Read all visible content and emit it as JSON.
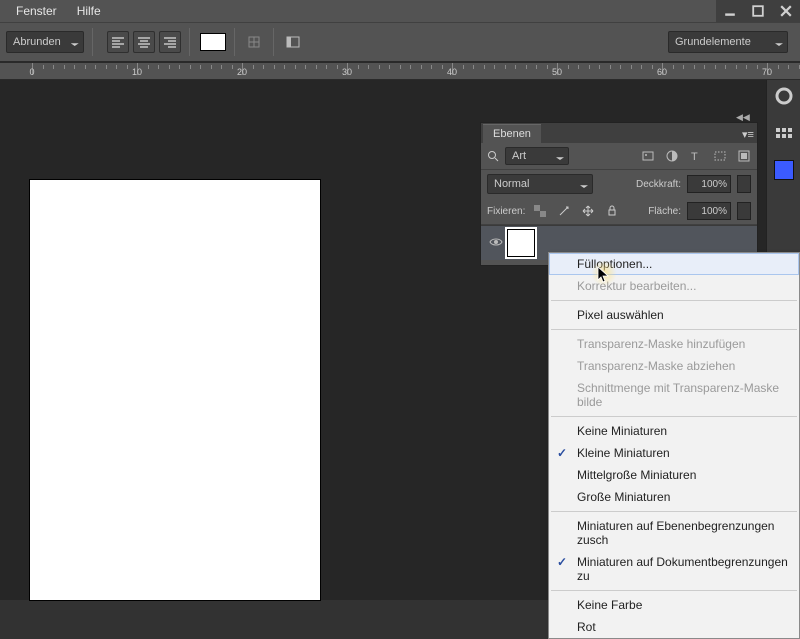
{
  "menubar": {
    "fenster": "Fenster",
    "hilfe": "Hilfe"
  },
  "optbar": {
    "corner_style": "Abrunden",
    "modes_dropdown": "Grundelemente"
  },
  "ruler": {
    "ticks": [
      0,
      10,
      20,
      30,
      40,
      50,
      60,
      70
    ]
  },
  "panel": {
    "title": "Ebenen",
    "filter_label": "Art",
    "blend_mode": "Normal",
    "opacity_label": "Deckkraft:",
    "opacity_value": "100%",
    "lock_label": "Fixieren:",
    "fill_label": "Fläche:",
    "fill_value": "100%"
  },
  "ctx": {
    "fill_options": "Fülloptionen...",
    "edit_adjustment": "Korrektur bearbeiten...",
    "select_pixels": "Pixel auswählen",
    "add_trans_mask": "Transparenz-Maske hinzufügen",
    "subtract_trans_mask": "Transparenz-Maske abziehen",
    "intersect_trans_mask": "Schnittmenge mit Transparenz-Maske bilde",
    "no_thumbs": "Keine Miniaturen",
    "small_thumbs": "Kleine Miniaturen",
    "med_thumbs": "Mittelgroße Miniaturen",
    "large_thumbs": "Große Miniaturen",
    "clip_layer_bounds": "Miniaturen auf Ebenenbegrenzungen zusch",
    "clip_doc_bounds": "Miniaturen auf Dokumentbegrenzungen zu",
    "no_color": "Keine Farbe",
    "red": "Rot"
  }
}
